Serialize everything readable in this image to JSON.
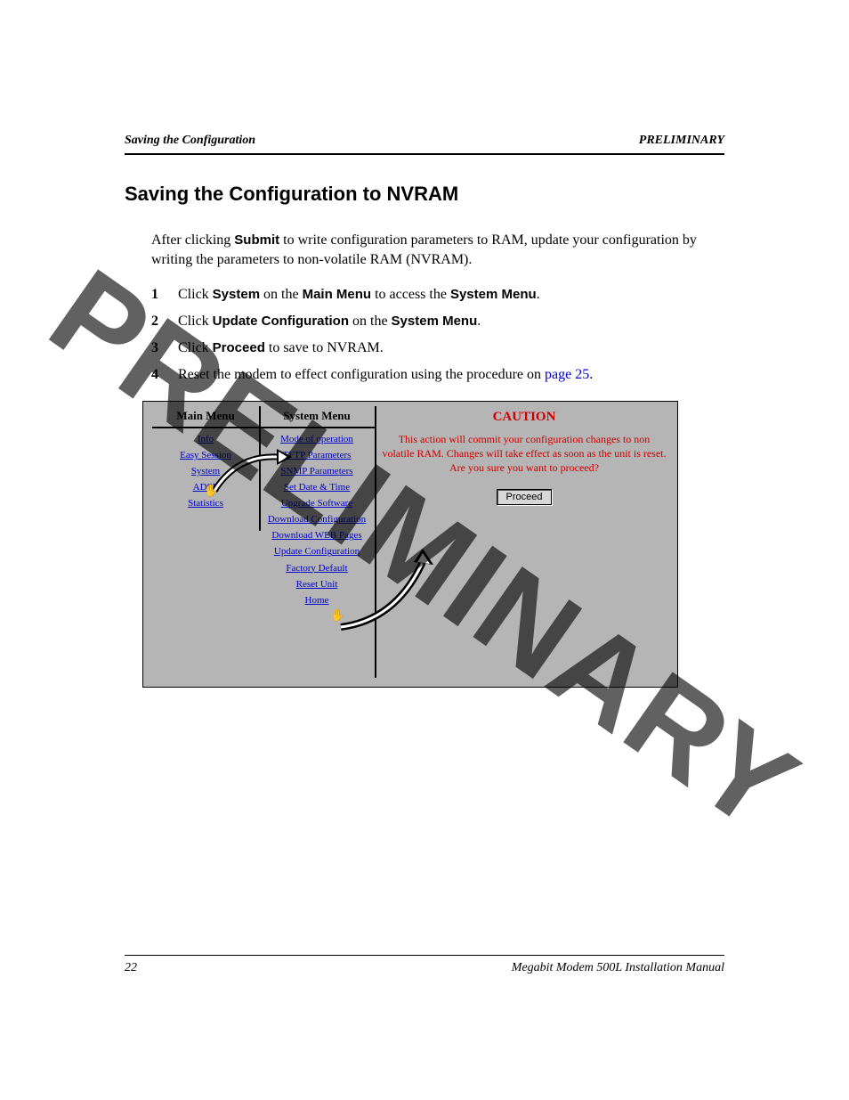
{
  "header": {
    "left": "Saving the Configuration",
    "right": "PRELIMINARY"
  },
  "title": "Saving the Configuration to NVRAM",
  "intro": {
    "part1": "After clicking ",
    "bold1": "Submit",
    "part2": " to write configuration parameters to RAM, update your configuration by writing the parameters to non-volatile RAM (NVRAM)."
  },
  "steps": [
    {
      "num": "1",
      "pre": "Click ",
      "b1": "System",
      "mid1": " on the ",
      "b2": "Main Menu",
      "mid2": " to access the ",
      "b3": "System Menu",
      "post": "."
    },
    {
      "num": "2",
      "pre": "Click ",
      "b1": "Update Configuration",
      "mid1": " on the ",
      "b2": "System Menu",
      "post": "."
    },
    {
      "num": "3",
      "pre": "Click ",
      "b1": "Proceed",
      "mid1": " to save to NVRAM.",
      "post": ""
    },
    {
      "num": "4",
      "pre": "Reset the modem to effect configuration using the procedure on ",
      "link": "page 25",
      "post": "."
    }
  ],
  "figure": {
    "main_menu": {
      "title": "Main Menu",
      "items": [
        "Info",
        "Easy Session",
        "System",
        "ADSL",
        "Statistics"
      ]
    },
    "system_menu": {
      "title": "System Menu",
      "items": [
        "Mode of operation",
        "TFTP Parameters",
        "SNMP Parameters",
        "Set Date & Time",
        "Upgrade Software",
        "Download Configuration",
        "Download WEB Pages",
        "Update Configuration",
        "Factory Default",
        "Reset Unit",
        "Home"
      ]
    },
    "caution": {
      "title": "CAUTION",
      "text": "This action will commit your configuration changes to non volatile RAM.  Changes will take effect as soon as the unit is reset.  Are you sure you want to proceed?",
      "button": "Proceed"
    }
  },
  "watermark": "PRELIMINARY",
  "footer": {
    "page": "22",
    "title": "Megabit Modem 500L Installation Manual"
  }
}
